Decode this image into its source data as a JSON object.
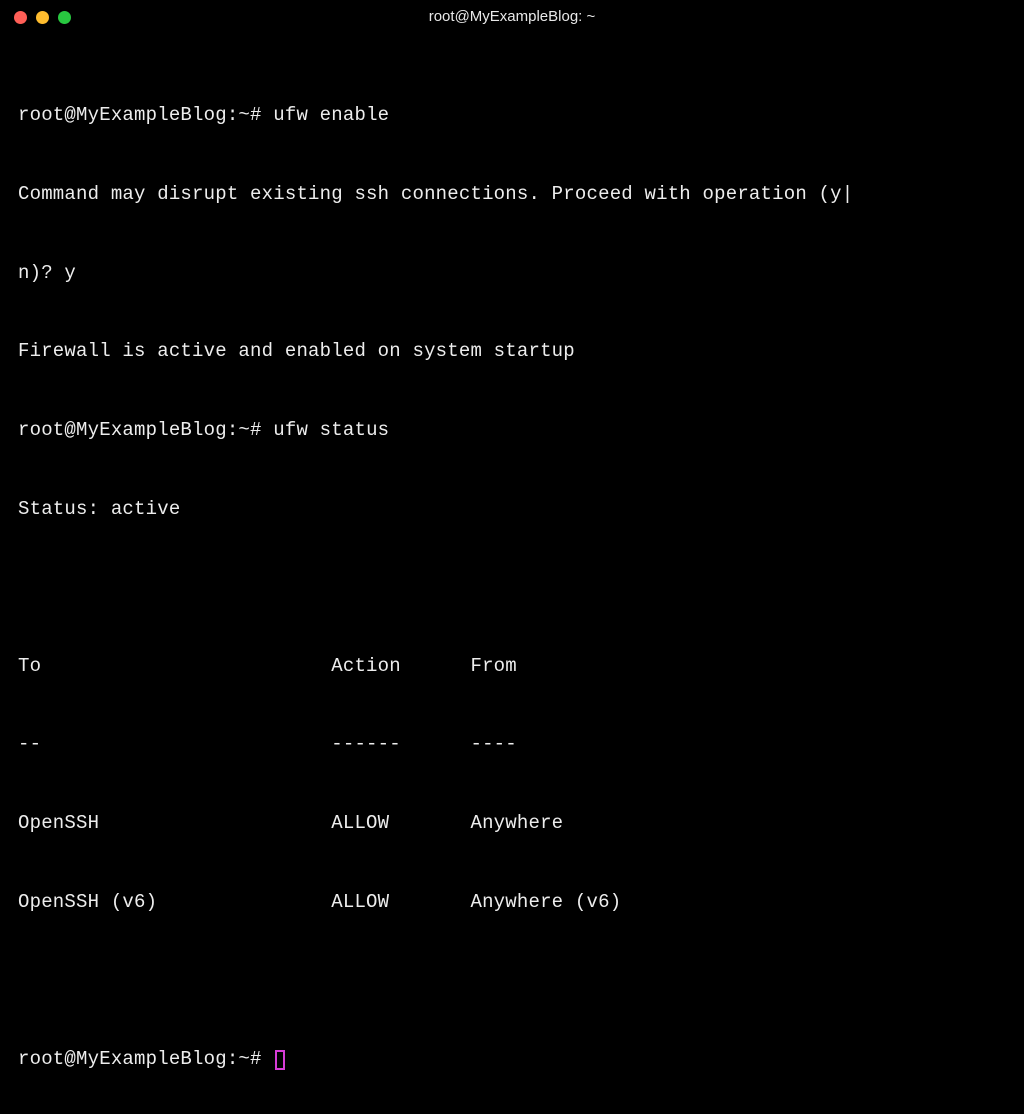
{
  "window": {
    "title": "root@MyExampleBlog: ~"
  },
  "prompt": "root@MyExampleBlog:~#",
  "session": {
    "cmd1": "ufw enable",
    "out1_line1": "Command may disrupt existing ssh connections. Proceed with operation (y|",
    "out1_line2": "n)? y",
    "out1_line3": "Firewall is active and enabled on system startup",
    "cmd2": "ufw status",
    "out2_status": "Status: active",
    "table": {
      "header": "To                         Action      From",
      "separator": "--                         ------      ----",
      "row1": "OpenSSH                    ALLOW       Anywhere",
      "row2": "OpenSSH (v6)               ALLOW       Anywhere (v6)"
    }
  }
}
